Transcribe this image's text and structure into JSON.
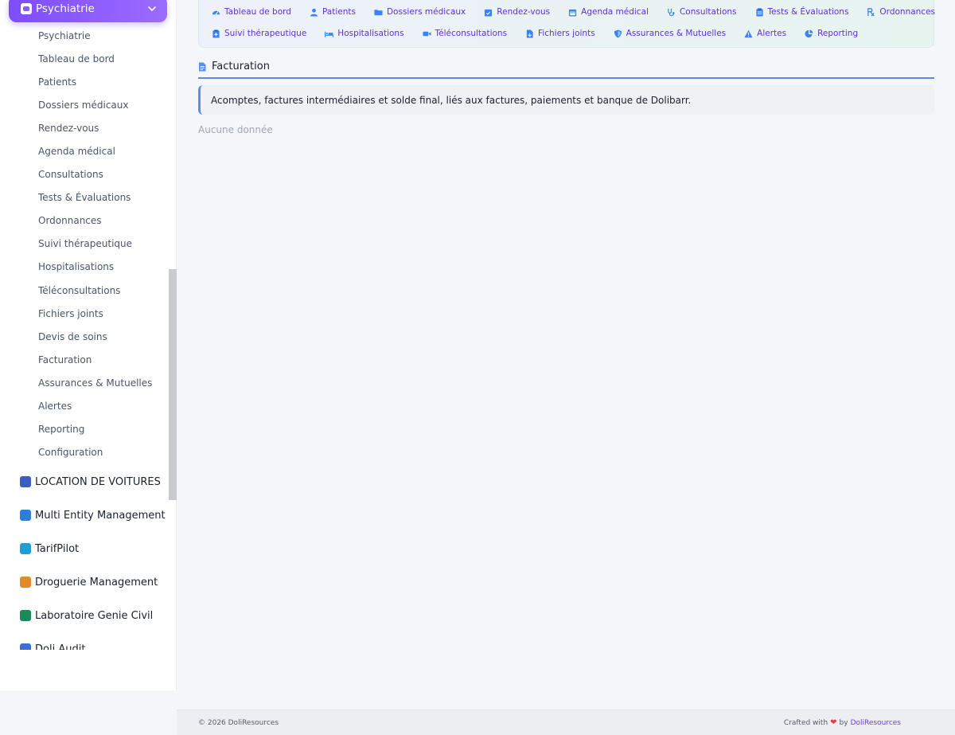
{
  "sidebar": {
    "active_module": "Psychiatrie",
    "submenu": [
      "Psychiatrie",
      "Tableau de bord",
      "Patients",
      "Dossiers médicaux",
      "Rendez-vous",
      "Agenda médical",
      "Consultations",
      "Tests & Évaluations",
      "Ordonnances",
      "Suivi thérapeutique",
      "Hospitalisations",
      "Téléconsultations",
      "Fichiers joints",
      "Devis de soins",
      "Facturation",
      "Assurances & Mutuelles",
      "Alertes",
      "Reporting",
      "Configuration"
    ],
    "modules": [
      {
        "label": "LOCATION DE VOITURES",
        "color": "#3b5fbf"
      },
      {
        "label": "Multi Entity Management",
        "color": "#2b7fd4"
      },
      {
        "label": "TarifPilot",
        "color": "#1f9fd6"
      },
      {
        "label": "Droguerie Management",
        "color": "#e08a2c"
      },
      {
        "label": "Laboratoire Genie Civil",
        "color": "#1b8a5a"
      },
      {
        "label": "Doli Audit",
        "color": "#3a6fd8"
      }
    ]
  },
  "topnav": {
    "row1": [
      {
        "label": "Tableau de bord",
        "icon": "gauge-icon"
      },
      {
        "label": "Patients",
        "icon": "user-icon"
      },
      {
        "label": "Dossiers médicaux",
        "icon": "folder-icon"
      },
      {
        "label": "Rendez-vous",
        "icon": "calendar-check-icon"
      },
      {
        "label": "Agenda médical",
        "icon": "calendar-icon"
      },
      {
        "label": "Consultations",
        "icon": "stethoscope-icon"
      },
      {
        "label": "Tests & Évaluations",
        "icon": "clipboard-icon"
      },
      {
        "label": "Ordonnances",
        "icon": "prescription-icon"
      }
    ],
    "row2": [
      {
        "label": "Suivi thérapeutique",
        "icon": "notes-medical-icon"
      },
      {
        "label": "Hospitalisations",
        "icon": "bed-icon"
      },
      {
        "label": "Téléconsultations",
        "icon": "video-icon"
      },
      {
        "label": "Fichiers joints",
        "icon": "file-icon"
      },
      {
        "label": "Assurances & Mutuelles",
        "icon": "shield-icon"
      },
      {
        "label": "Alertes",
        "icon": "warning-icon"
      },
      {
        "label": "Reporting",
        "icon": "pie-chart-icon"
      }
    ]
  },
  "section": {
    "title": "Facturation",
    "description": "Acomptes, factures intermédiaires et solde final, liés aux factures, paiements et banque de Dolibarr.",
    "empty": "Aucune donnée"
  },
  "footer": {
    "copyright": "© 2026 DoliResources",
    "crafted": "Crafted with",
    "by": "by",
    "brand": "DoliResources"
  },
  "colors": {
    "accent": "#7c4dff",
    "link": "#5b32d6",
    "section_line": "#4f8fe8"
  }
}
